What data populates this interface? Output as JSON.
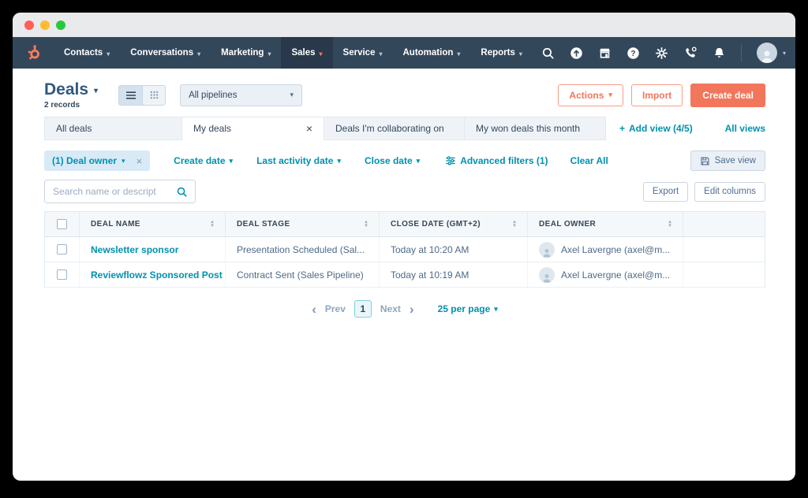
{
  "icons": {
    "chevron_down": "▾",
    "sort_up": "▴",
    "sort_down": "▾",
    "close": "×",
    "plus": "+",
    "chevron_left": "‹",
    "chevron_right": "›"
  },
  "nav": {
    "items": [
      {
        "label": "Contacts"
      },
      {
        "label": "Conversations"
      },
      {
        "label": "Marketing"
      },
      {
        "label": "Sales"
      },
      {
        "label": "Service"
      },
      {
        "label": "Automation"
      },
      {
        "label": "Reports"
      }
    ]
  },
  "header": {
    "title": "Deals",
    "record_count": "2 records",
    "pipeline_filter": "All pipelines",
    "actions_label": "Actions",
    "import_label": "Import",
    "create_deal_label": "Create deal"
  },
  "tabs": {
    "items": [
      {
        "label": "All deals"
      },
      {
        "label": "My deals"
      },
      {
        "label": "Deals I'm collaborating on"
      },
      {
        "label": "My won deals this month"
      }
    ],
    "add_view_label": "Add view (4/5)",
    "all_views_label": "All views"
  },
  "filters": {
    "owner_chip": "(1) Deal owner",
    "create_date": "Create date",
    "last_activity": "Last activity date",
    "close_date": "Close date",
    "advanced": "Advanced filters (1)",
    "clear_all": "Clear All",
    "save_view": "Save view"
  },
  "toolbar": {
    "search_placeholder": "Search name or descript",
    "export_label": "Export",
    "edit_columns_label": "Edit columns"
  },
  "table": {
    "columns": [
      "DEAL NAME",
      "DEAL STAGE",
      "CLOSE DATE (GMT+2)",
      "DEAL OWNER"
    ],
    "rows": [
      {
        "name": "Newsletter sponsor",
        "stage": "Presentation Scheduled (Sal...",
        "close": "Today at 10:20 AM",
        "owner": "Axel Lavergne (axel@m..."
      },
      {
        "name": "Reviewflowz Sponsored Post",
        "stage": "Contract Sent (Sales Pipeline)",
        "close": "Today at 10:19 AM",
        "owner": "Axel Lavergne (axel@m..."
      }
    ]
  },
  "pagination": {
    "prev": "Prev",
    "page": "1",
    "next": "Next",
    "per_page": "25 per page"
  },
  "colors": {
    "accent_orange": "#f2765c",
    "nav_navy": "#33475b",
    "link_teal": "#0091ae"
  }
}
